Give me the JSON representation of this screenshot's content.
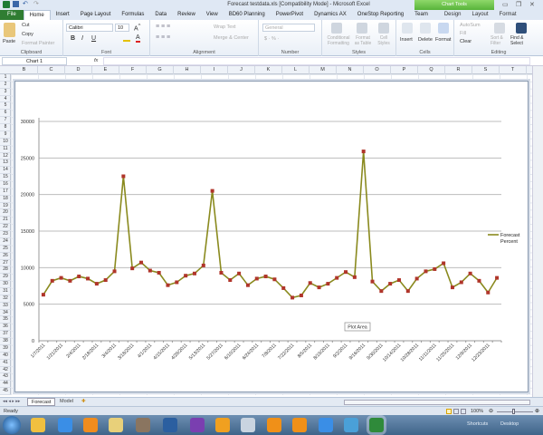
{
  "window": {
    "title": "Forecast testdata.xls  [Compatibility Mode]  -  Microsoft Excel",
    "context_tab": "Chart Tools"
  },
  "tabs": [
    "File",
    "Home",
    "Insert",
    "Page Layout",
    "Formulas",
    "Data",
    "Review",
    "View",
    "BD60 Planning",
    "PowerPivot",
    "Dynamics AX",
    "OneStop Reporting",
    "Team",
    "Design",
    "Layout",
    "Format"
  ],
  "ribbon": {
    "clipboard": {
      "paste": "Paste",
      "cut": "Cut",
      "copy": "Copy",
      "format_painter": "Format Painter",
      "label": "Clipboard"
    },
    "font": {
      "name": "Calibri",
      "size": "10",
      "bold": "B",
      "italic": "I",
      "underline": "U",
      "label": "Font"
    },
    "alignment": {
      "wrap": "Wrap Text",
      "merge": "Merge & Center",
      "label": "Alignment"
    },
    "number": {
      "format": "General",
      "label": "Number"
    },
    "styles": {
      "conditional": "Conditional Formatting",
      "format_table": "Format as Table",
      "cell_styles": "Cell Styles",
      "label": "Styles"
    },
    "cells": {
      "insert": "Insert",
      "delete": "Delete",
      "format": "Format",
      "label": "Cells"
    },
    "editing": {
      "autosum": "AutoSum",
      "fill": "Fill",
      "clear": "Clear",
      "sort": "Sort & Filter",
      "find": "Find & Select",
      "label": "Editing"
    }
  },
  "formula_bar": {
    "name_box": "Chart 1",
    "fx": "fx",
    "value": ""
  },
  "columns": [
    "B",
    "C",
    "D",
    "E",
    "F",
    "G",
    "H",
    "I",
    "J",
    "K",
    "L",
    "M",
    "N",
    "O",
    "P",
    "Q",
    "R",
    "S",
    "T"
  ],
  "row_count": 45,
  "sheets": [
    "Forecast",
    "Model"
  ],
  "status": {
    "ready": "Ready",
    "zoom": "100%"
  },
  "taskbar": {
    "shortcuts": "Shortcuts",
    "desktop": "Desktop"
  },
  "chart_data": {
    "type": "line",
    "series": [
      {
        "name": "Forecast Percent",
        "values": [
          6300,
          8200,
          8600,
          8200,
          8800,
          8500,
          7800,
          8300,
          9500,
          22500,
          9900,
          10700,
          9600,
          9300,
          7600,
          8000,
          8900,
          9200,
          10300,
          20500,
          9300,
          8300,
          9200,
          7600,
          8500,
          8800,
          8400,
          7200,
          5900,
          6200,
          7900,
          7300,
          7800,
          8600,
          9400,
          8700,
          25900,
          8100,
          6800,
          7800,
          8300,
          6800,
          8500,
          9500,
          9800,
          10600,
          7300,
          8000,
          9200,
          8200,
          6600,
          8600
        ]
      }
    ],
    "x_tick_labels": [
      "1/7/2011",
      "1/21/2011",
      "2/4/2011",
      "2/18/2011",
      "3/4/2011",
      "3/18/2011",
      "4/1/2011",
      "4/15/2011",
      "4/29/2011",
      "5/13/2011",
      "5/27/2011",
      "6/10/2011",
      "6/24/2011",
      "7/8/2011",
      "7/22/2011",
      "8/5/2011",
      "8/19/2011",
      "9/2/2011",
      "9/16/2011",
      "9/30/2011",
      "10/14/2011",
      "10/28/2011",
      "11/11/2011",
      "11/25/2011",
      "12/9/2011",
      "12/23/2011"
    ],
    "y_ticks": [
      "0",
      "5000",
      "10000",
      "15000",
      "20000",
      "25000",
      "30000"
    ],
    "ylim": [
      0,
      30000
    ],
    "grid": true,
    "legend_placement": "right",
    "tooltip": "Plot Area",
    "line_color": "#8a8a1e",
    "marker_color": "#b0352a"
  }
}
